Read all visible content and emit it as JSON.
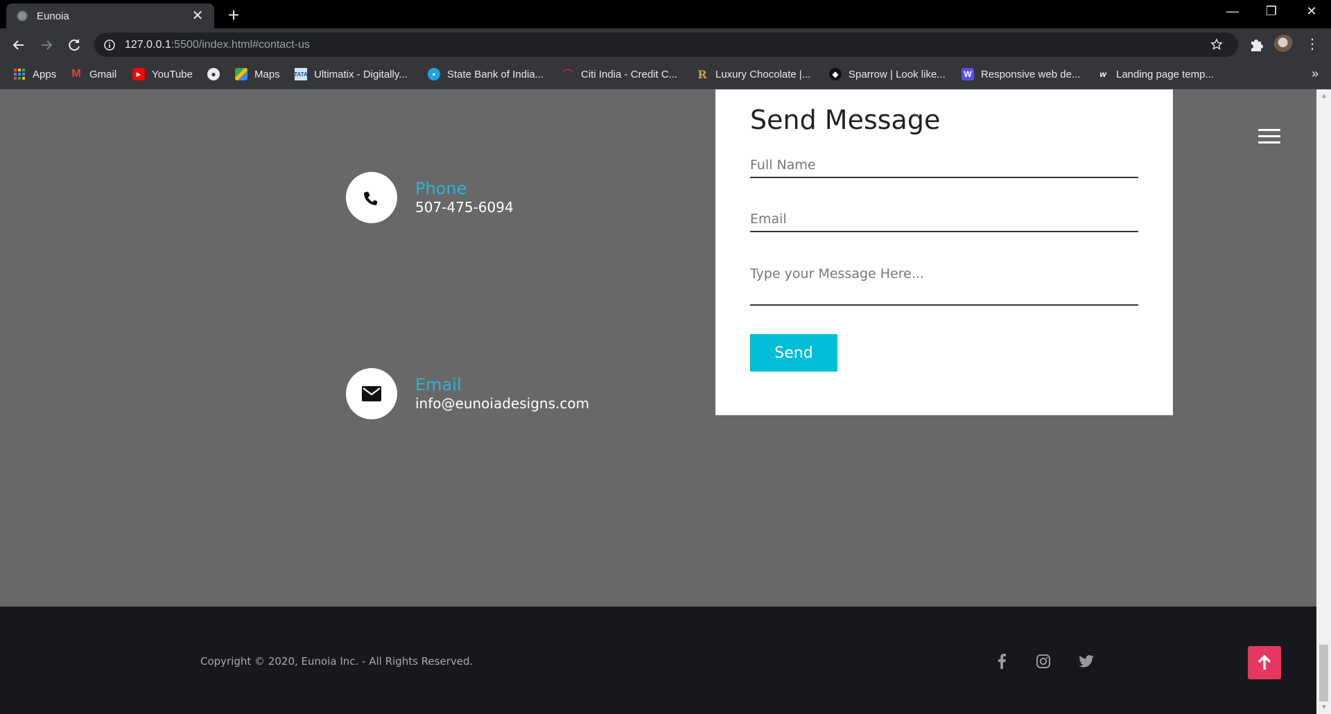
{
  "browser": {
    "tab_title": "Eunoia",
    "url_host": "127.0.0.1",
    "url_rest": ":5500/index.html#contact-us",
    "bookmarks": [
      {
        "label": "Apps",
        "icon": "apps-grid-icon"
      },
      {
        "label": "Gmail",
        "icon": "gmail-icon"
      },
      {
        "label": "YouTube",
        "icon": "youtube-icon"
      },
      {
        "label": "",
        "icon": "globe-icon"
      },
      {
        "label": "Maps",
        "icon": "maps-icon"
      },
      {
        "label": "Ultimatix - Digitally...",
        "icon": "tata-icon"
      },
      {
        "label": "State Bank of India...",
        "icon": "sbi-icon"
      },
      {
        "label": "Citi India - Credit C...",
        "icon": "citi-icon"
      },
      {
        "label": "Luxury Chocolate |...",
        "icon": "r-icon"
      },
      {
        "label": "Sparrow | Look like...",
        "icon": "sparrow-icon"
      },
      {
        "label": "Responsive web de...",
        "icon": "w-purple-icon"
      },
      {
        "label": "Landing page temp...",
        "icon": "w-icon"
      }
    ]
  },
  "contact": {
    "phone_label": "Phone",
    "phone_value": "507-475-6094",
    "email_label": "Email",
    "email_value": "info@eunoiadesigns.com"
  },
  "form": {
    "title": "Send Message",
    "name_placeholder": "Full Name",
    "email_placeholder": "Email",
    "message_placeholder": "Type your Message Here...",
    "send_label": "Send"
  },
  "footer": {
    "copyright": "Copyright © 2020, Eunoia Inc. - All Rights Reserved."
  },
  "colors": {
    "accent": "#29b6d6",
    "send_button": "#00bcd4",
    "to_top": "#e5375f",
    "page_bg": "#686868",
    "footer_bg": "#17181d"
  }
}
